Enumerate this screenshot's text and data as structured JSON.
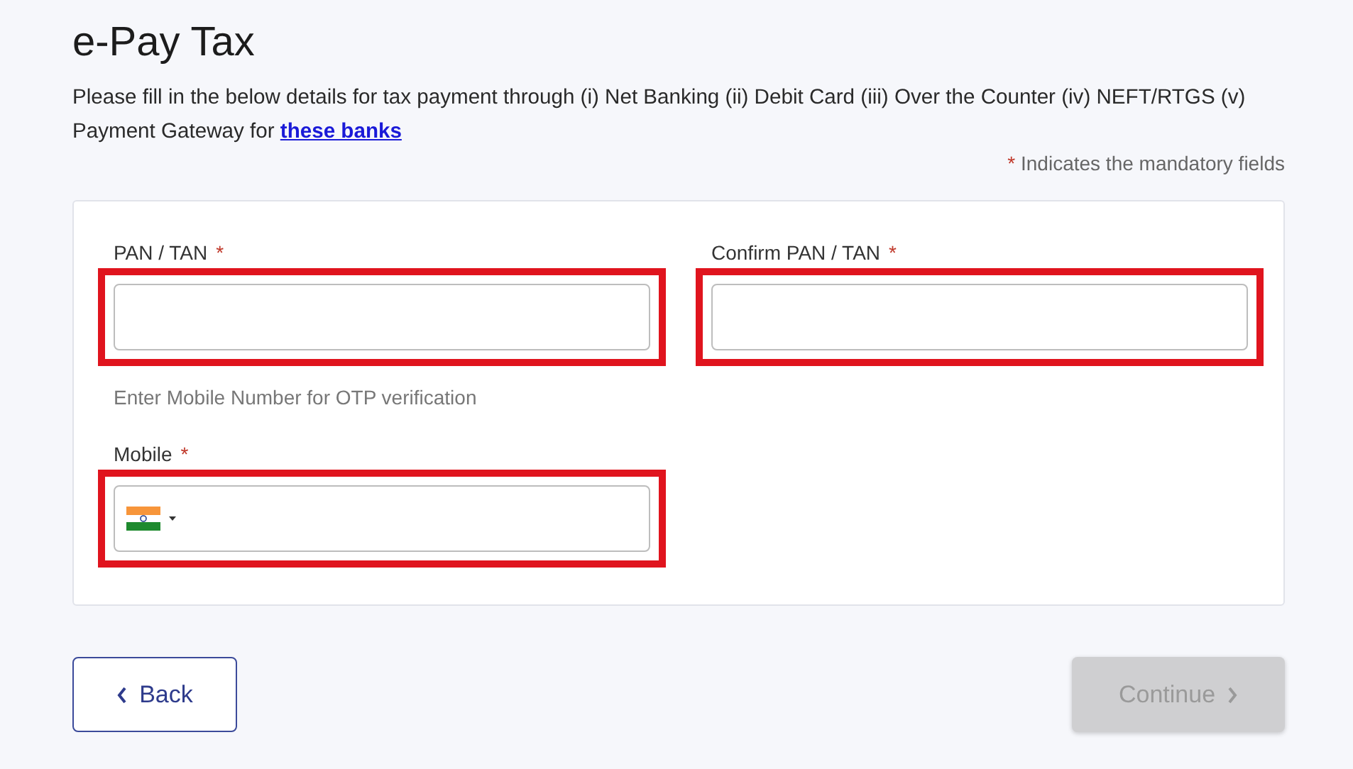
{
  "title": "e-Pay Tax",
  "description": {
    "text": "Please fill in the below details for tax payment through (i) Net Banking (ii) Debit Card (iii) Over the Counter (iv) NEFT/RTGS (v) Payment Gateway for",
    "link": "these banks"
  },
  "mandatory_note": {
    "mark": "*",
    "text": "Indicates the mandatory fields"
  },
  "fields": [
    {
      "kind": "text",
      "label": "PAN / TAN",
      "required_mark": "*",
      "highlighted": true
    },
    {
      "kind": "text",
      "label": "Confirm PAN / TAN",
      "required_mark": "*",
      "highlighted": true
    },
    {
      "kind": "phone",
      "hint": "Enter Mobile Number for OTP verification",
      "label": "Mobile",
      "required_mark": "*",
      "highlighted": true
    }
  ],
  "buttons": [
    {
      "kind": "back",
      "label": "Back",
      "disabled": false
    },
    {
      "kind": "continue",
      "label": "Continue",
      "disabled": true
    }
  ]
}
